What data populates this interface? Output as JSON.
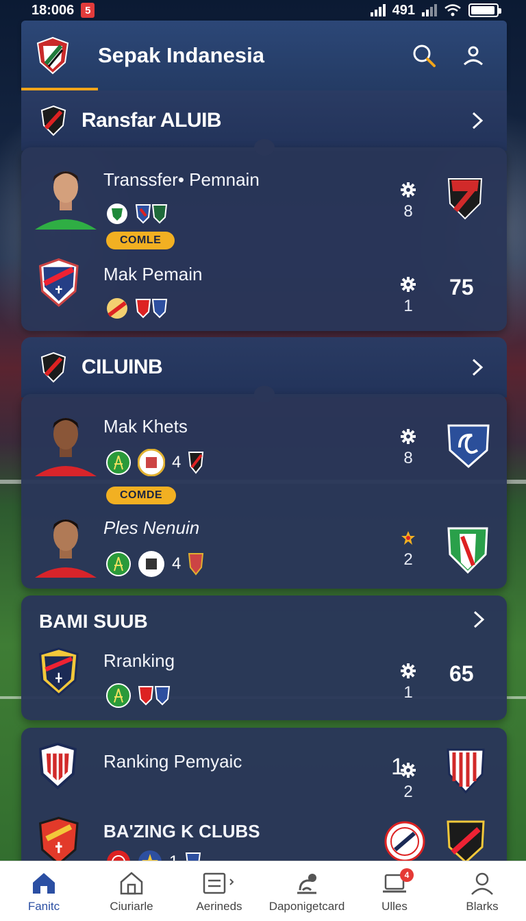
{
  "status": {
    "time": "18:006",
    "notification": "5",
    "signal_text": "491"
  },
  "header": {
    "title": "Sepak Indanesia"
  },
  "sections": [
    {
      "title": "Ransfar ALUIB",
      "rows": [
        {
          "name": "Transsfer• Pemnain",
          "stat": "8",
          "pill": "COMLE"
        },
        {
          "name": "Mak Pemain",
          "stat": "1",
          "score": "75"
        }
      ]
    },
    {
      "title": "CILUINB",
      "rows": [
        {
          "name": "Mak Khets",
          "stat": "8",
          "count": "4",
          "pill": "COMDE"
        },
        {
          "name": "Ples Nenuin",
          "stat": "2",
          "count": "4"
        }
      ]
    },
    {
      "title": "BAMI SUUB",
      "rows": [
        {
          "name": "Rranking",
          "stat": "1",
          "score": "65"
        }
      ]
    },
    {
      "title": "",
      "rows": [
        {
          "name": "Ranking Pemyaic",
          "stat": "2",
          "prefix": "1"
        },
        {
          "name": "BA'ZING K CLUBS",
          "count": "1"
        }
      ]
    }
  ],
  "nav": [
    {
      "label": "Fanitc",
      "icon": "home-icon"
    },
    {
      "label": "Ciuriarle",
      "icon": "building-icon"
    },
    {
      "label": "Aerineds",
      "icon": "list-icon"
    },
    {
      "label": "Daponigetcard",
      "icon": "scale-icon"
    },
    {
      "label": "Ulles",
      "icon": "laptop-icon",
      "badge": "4"
    },
    {
      "label": "Blarks",
      "icon": "user-icon"
    }
  ],
  "colors": {
    "accent": "#f2a51a",
    "header": "#2c4777",
    "card": "#2a3658",
    "nav_active": "#2b4fa3"
  }
}
